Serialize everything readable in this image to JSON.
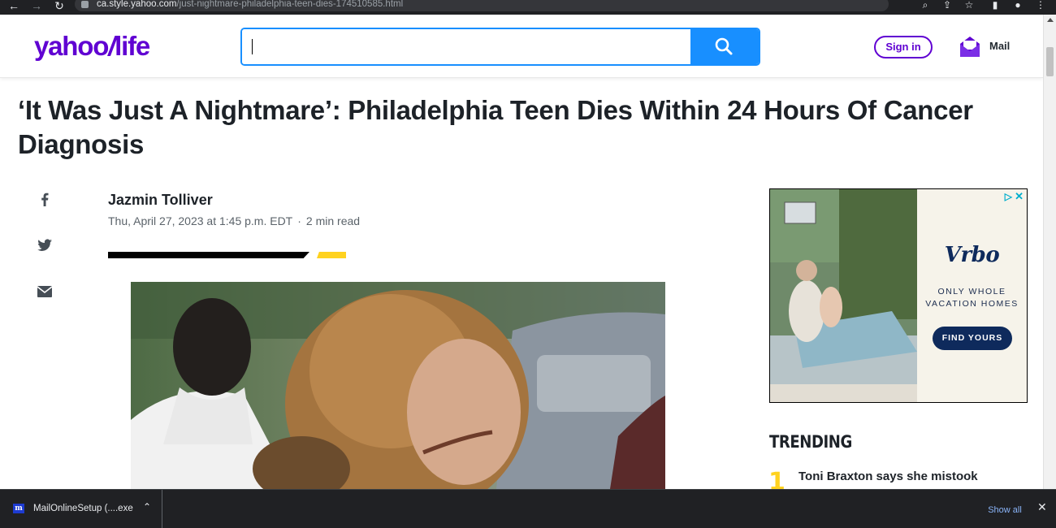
{
  "browser": {
    "url_host": "ca.style.yahoo.com",
    "url_path": "/just-nightmare-philadelphia-teen-dies-174510585.html"
  },
  "header": {
    "logo_yahoo": "yahoo",
    "logo_slash": "/",
    "logo_life": "life",
    "search_value": "",
    "signin_label": "Sign in",
    "mail_label": "Mail"
  },
  "article": {
    "headline": "‘It Was Just A Nightmare’: Philadelphia Teen Dies Within 24 Hours Of Cancer Diagnosis",
    "author": "Jazmin Tolliver",
    "date": "Thu, April 27, 2023 at 1:45 p.m. EDT",
    "separator": "·",
    "read_time": "2 min read"
  },
  "ad": {
    "brand": "Vrbo",
    "tagline_line1": "ONLY WHOLE",
    "tagline_line2": "VACATION HOMES",
    "cta": "FIND YOURS"
  },
  "trending": {
    "heading": "TRENDING",
    "items": [
      {
        "number": "1",
        "text": "Toni Braxton says she mistook 'widow-"
      }
    ]
  },
  "downloads": {
    "item_name": "MailOnlineSetup (....exe",
    "show_all": "Show all"
  },
  "colors": {
    "brand_purple": "#6001d2",
    "search_blue": "#188fff",
    "accent_yellow": "#ffd21f",
    "vrbo_navy": "#0e2a5c"
  }
}
